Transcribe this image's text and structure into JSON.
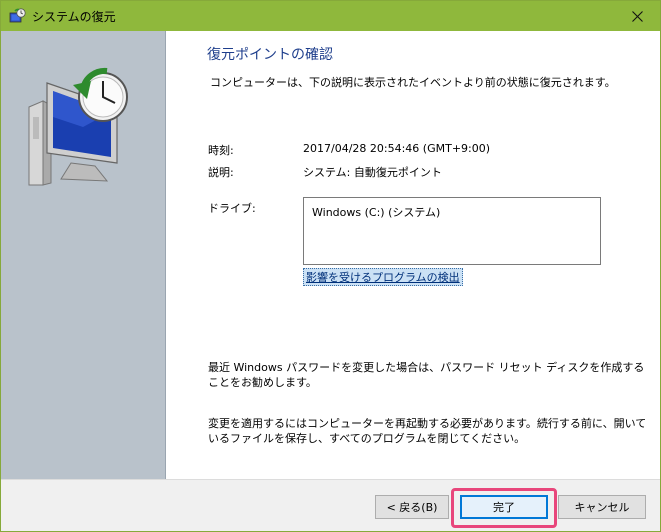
{
  "window": {
    "title": "システムの復元",
    "icons": {
      "app": "system-restore-icon",
      "close": "close-icon",
      "hero": "restore-computer-icon"
    }
  },
  "main": {
    "heading": "復元ポイントの確認",
    "description": "コンピューターは、下の説明に表示されたイベントより前の状態に復元されます。",
    "time_label": "時刻:",
    "time_value": "2017/04/28 20:54:46 (GMT+9:00)",
    "desc_label": "説明:",
    "desc_value": "システム: 自動復元ポイント",
    "drive_label": "ドライブ:",
    "drives": [
      "Windows (C:) (システム)"
    ],
    "scan_link": "影響を受けるプログラムの検出",
    "note1": "最近 Windows パスワードを変更した場合は、パスワード リセット ディスクを作成することをお勧めします。",
    "note2": "変更を適用するにはコンピューターを再起動する必要があります。続行する前に、開いているファイルを保存し、すべてのプログラムを閉じてください。"
  },
  "footer": {
    "back_label": "< 戻る(B)",
    "finish_label": "完了",
    "cancel_label": "キャンセル"
  },
  "colors": {
    "titlebar": "#8fb83c",
    "heading": "#1e3e8c",
    "highlight": "#e8467b",
    "focus": "#0078d7"
  }
}
